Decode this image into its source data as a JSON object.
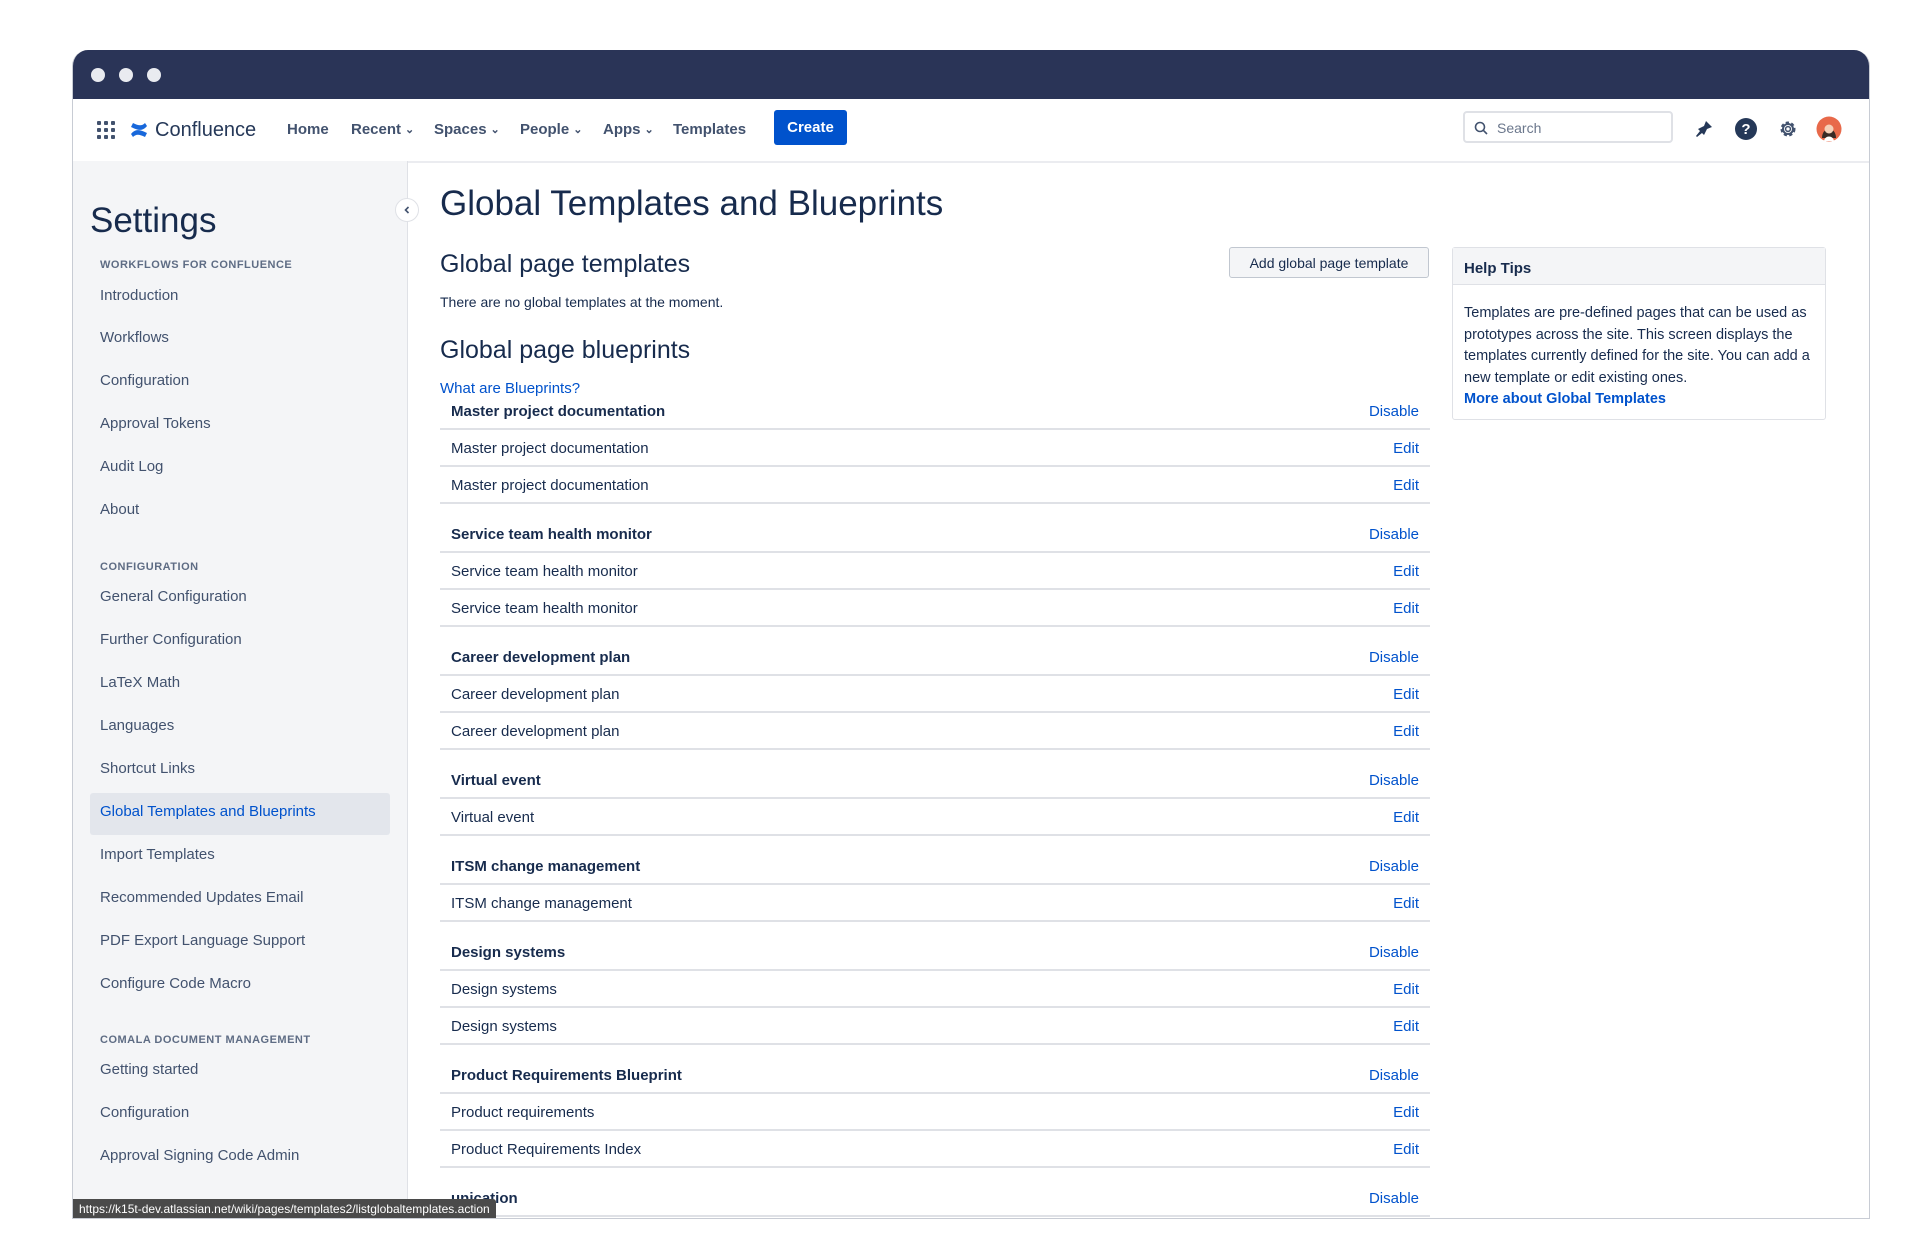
{
  "nav": {
    "product": "Confluence",
    "items": [
      {
        "label": "Home",
        "dropdown": false
      },
      {
        "label": "Recent",
        "dropdown": true
      },
      {
        "label": "Spaces",
        "dropdown": true
      },
      {
        "label": "People",
        "dropdown": true
      },
      {
        "label": "Apps",
        "dropdown": true
      },
      {
        "label": "Templates",
        "dropdown": false
      }
    ],
    "create_label": "Create",
    "search_placeholder": "Search",
    "icons": [
      "notifications-icon",
      "help-icon",
      "settings-icon",
      "avatar"
    ]
  },
  "sidebar": {
    "title": "Settings",
    "sections": [
      {
        "heading": "WORKFLOWS FOR CONFLUENCE",
        "items": [
          "Introduction",
          "Workflows",
          "Configuration",
          "Approval Tokens",
          "Audit Log",
          "About"
        ]
      },
      {
        "heading": "CONFIGURATION",
        "items": [
          "General Configuration",
          "Further Configuration",
          "LaTeX Math",
          "Languages",
          "Shortcut Links",
          "Global Templates and Blueprints",
          "Import Templates",
          "Recommended Updates Email",
          "PDF Export Language Support",
          "Configure Code Macro"
        ]
      },
      {
        "heading": "COMALA DOCUMENT MANAGEMENT",
        "items": [
          "Getting started",
          "Configuration",
          "Approval Signing Code Admin"
        ]
      }
    ],
    "active_item": "Global Templates and Blueprints"
  },
  "main": {
    "title": "Global Templates and Blueprints",
    "templates_heading": "Global page templates",
    "add_button": "Add global page template",
    "no_templates": "There are no global templates at the moment.",
    "blueprints_heading": "Global page blueprints",
    "what_link": "What are Blueprints?",
    "rows": [
      {
        "name": "Master project documentation",
        "action": "Disable",
        "head": true
      },
      {
        "name": "Master project documentation",
        "action": "Edit",
        "head": false
      },
      {
        "name": "Master project documentation",
        "action": "Edit",
        "head": false
      },
      {
        "name": "Service team health monitor",
        "action": "Disable",
        "head": true
      },
      {
        "name": "Service team health monitor",
        "action": "Edit",
        "head": false
      },
      {
        "name": "Service team health monitor",
        "action": "Edit",
        "head": false
      },
      {
        "name": "Career development plan",
        "action": "Disable",
        "head": true
      },
      {
        "name": "Career development plan",
        "action": "Edit",
        "head": false
      },
      {
        "name": "Career development plan",
        "action": "Edit",
        "head": false
      },
      {
        "name": "Virtual event",
        "action": "Disable",
        "head": true
      },
      {
        "name": "Virtual event",
        "action": "Edit",
        "head": false
      },
      {
        "name": "ITSM change management",
        "action": "Disable",
        "head": true
      },
      {
        "name": "ITSM change management",
        "action": "Edit",
        "head": false
      },
      {
        "name": "Design systems",
        "action": "Disable",
        "head": true
      },
      {
        "name": "Design systems",
        "action": "Edit",
        "head": false
      },
      {
        "name": "Design systems",
        "action": "Edit",
        "head": false
      },
      {
        "name": "Product Requirements Blueprint",
        "action": "Disable",
        "head": true
      },
      {
        "name": "Product requirements",
        "action": "Edit",
        "head": false
      },
      {
        "name": "Product Requirements Index",
        "action": "Edit",
        "head": false
      },
      {
        "name": "unication",
        "action": "Disable",
        "head": true
      }
    ]
  },
  "help": {
    "title": "Help Tips",
    "body": "Templates are pre-defined pages that can be used as prototypes across the site. This screen displays the templates currently defined for the site. You can add a new template or edit existing ones.",
    "link": "More about Global Templates"
  },
  "status_url": "https://k15t-dev.atlassian.net/wiki/pages/templates2/listglobaltemplates.action",
  "colors": {
    "brand": "#0052cc",
    "titlebar": "#2a3457"
  }
}
